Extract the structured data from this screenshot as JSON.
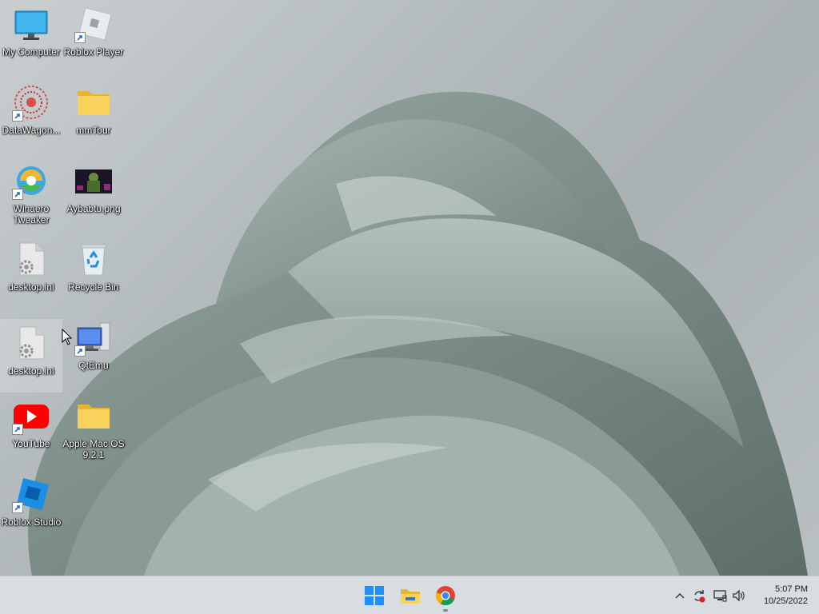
{
  "desktop_icons": [
    {
      "name": "my-computer",
      "label": "My Computer",
      "icon": "monitor-icon"
    },
    {
      "name": "roblox-player",
      "label": "Roblox Player",
      "icon": "roblox-player-icon"
    },
    {
      "name": "datawagon",
      "label": "DataWagon...",
      "icon": "datawagon-icon"
    },
    {
      "name": "mmtour",
      "label": "mmTour",
      "icon": "folder-icon"
    },
    {
      "name": "winaero-tweaker",
      "label": "Winaero Tweaker",
      "icon": "winaero-icon"
    },
    {
      "name": "aybabtu",
      "label": "Aybabtu.png",
      "icon": "image-thumbnail-icon"
    },
    {
      "name": "desktop-ini-1",
      "label": "desktop.ini",
      "icon": "settings-file-icon"
    },
    {
      "name": "recycle-bin",
      "label": "Recycle Bin",
      "icon": "recycle-bin-icon"
    },
    {
      "name": "desktop-ini-2",
      "label": "desktop.ini",
      "icon": "settings-file-icon"
    },
    {
      "name": "qtemu",
      "label": "QtEmu",
      "icon": "qtemu-icon"
    },
    {
      "name": "youtube",
      "label": "YouTube",
      "icon": "youtube-icon"
    },
    {
      "name": "apple-mac-os",
      "label": "Apple Mac OS 9.2.1",
      "icon": "folder-icon"
    },
    {
      "name": "roblox-studio",
      "label": "Roblox Studio",
      "icon": "roblox-studio-icon"
    }
  ],
  "taskbar": {
    "pinned": [
      {
        "name": "start-button",
        "icon": "windows-logo-icon"
      },
      {
        "name": "file-explorer-button",
        "icon": "file-explorer-icon"
      },
      {
        "name": "chrome-button",
        "icon": "chrome-icon"
      }
    ],
    "tray": [
      "chevron-up-icon",
      "sync-icon",
      "network-icon",
      "speaker-icon"
    ],
    "clock": {
      "time": "5:07 PM",
      "date": "10/25/2022"
    }
  },
  "colors": {
    "taskbar_bg": "#d7dde0",
    "wallpaper_petal": "#8fa09a",
    "folder_yellow": "#f5c842",
    "youtube_red": "#ff0000"
  }
}
